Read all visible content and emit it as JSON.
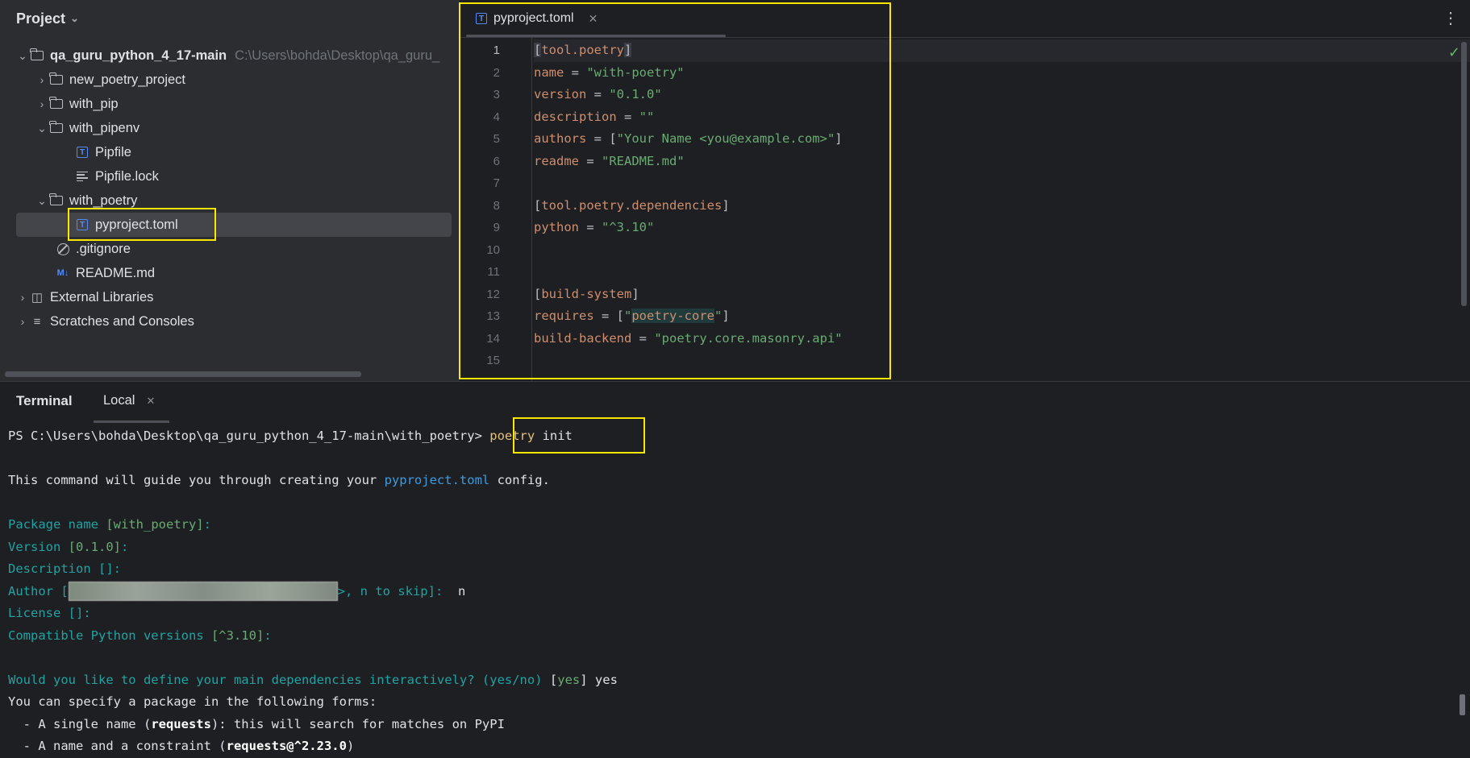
{
  "project": {
    "header": "Project",
    "tree": [
      {
        "label": "qa_guru_python_4_17-main",
        "hint": "C:\\Users\\bohda\\Desktop\\qa_guru_",
        "type": "root"
      },
      {
        "label": "new_poetry_project",
        "type": "folder-collapsed"
      },
      {
        "label": "with_pip",
        "type": "folder-collapsed"
      },
      {
        "label": "with_pipenv",
        "type": "folder-expanded"
      },
      {
        "label": "Pipfile",
        "type": "toml-file"
      },
      {
        "label": "Pipfile.lock",
        "type": "text-file"
      },
      {
        "label": "with_poetry",
        "type": "folder-expanded"
      },
      {
        "label": "pyproject.toml",
        "type": "toml-file",
        "selected": true
      },
      {
        "label": ".gitignore",
        "type": "ignore-file"
      },
      {
        "label": "README.md",
        "type": "markdown-file",
        "icon_text": "M↓"
      },
      {
        "label": "External Libraries",
        "type": "libraries"
      },
      {
        "label": "Scratches and Consoles",
        "type": "scratches"
      }
    ]
  },
  "editor": {
    "tab_label": "pyproject.toml",
    "tab_icon_text": "T",
    "line_numbers": [
      "1",
      "2",
      "3",
      "4",
      "5",
      "6",
      "7",
      "8",
      "9",
      "10",
      "11",
      "12",
      "13",
      "14",
      "15"
    ],
    "code": {
      "l1_open": "[",
      "l1_name": "tool.poetry",
      "l1_close": "]",
      "l2_key": "name",
      "l2_eq": " = ",
      "l2_val": "\"with-poetry\"",
      "l3_key": "version",
      "l3_eq": " = ",
      "l3_val": "\"0.1.0\"",
      "l4_key": "description",
      "l4_eq": " = ",
      "l4_val": "\"\"",
      "l5_key": "authors",
      "l5_eq": " = [",
      "l5_val": "\"Your Name <you@example.com>\"",
      "l5_close": "]",
      "l6_key": "readme",
      "l6_eq": " = ",
      "l6_val": "\"README.md\"",
      "l8_open": "[",
      "l8_name": "tool.poetry.dependencies",
      "l8_close": "]",
      "l9_key": "python",
      "l9_eq": " = ",
      "l9_val": "\"^3.10\"",
      "l12_open": "[",
      "l12_name": "build-system",
      "l12_close": "]",
      "l13_key": "requires",
      "l13_eq": " = [",
      "l13_q1": "\"",
      "l13_val": "poetry-core",
      "l13_q2": "\"",
      "l13_close": "]",
      "l14_key": "build-backend",
      "l14_eq": " = ",
      "l14_val": "\"poetry.core.masonry.api\""
    }
  },
  "terminal": {
    "title": "Terminal",
    "tab_label": "Local",
    "prompt": "PS C:\\Users\\bohda\\Desktop\\qa_guru_python_4_17-main\\with_poetry> ",
    "cmd_word": "poetry",
    "cmd_rest": " init",
    "guide_pre": "This command will guide you through creating your ",
    "guide_file": "pyproject.toml",
    "guide_post": " config.",
    "pkg_label": "Package name ",
    "pkg_default": "[with_poetry]",
    "pkg_colon": ":",
    "version_label": "Version ",
    "version_default": "[0.1.0]",
    "version_colon": ":",
    "desc_line": "Description []:",
    "author_pre": "Author [",
    "author_post": ">, n to skip]:",
    "author_answer": "  n",
    "license_line": "License []:",
    "compat_label": "Compatible Python versions ",
    "compat_default": "[^3.10]",
    "compat_colon": ":",
    "deps_q": "Would you like to define your main dependencies interactively? (yes/no) ",
    "deps_default_open": "[",
    "deps_default": "yes",
    "deps_default_close": "]",
    "deps_answer": " yes",
    "forms_line": "You can specify a package in the following forms:",
    "form1_pre": "  - A single name (",
    "form1_bold": "requests",
    "form1_post": "): this will search for matches on PyPI",
    "form2_pre": "  - A name and a constraint (",
    "form2_bold": "requests@^2.23.0",
    "form2_post": ")"
  },
  "colors": {
    "highlight": "#ffe600",
    "keyword": "#cf8e6d",
    "string": "#6aab73",
    "prompt_cyan": "#21a3a3"
  }
}
